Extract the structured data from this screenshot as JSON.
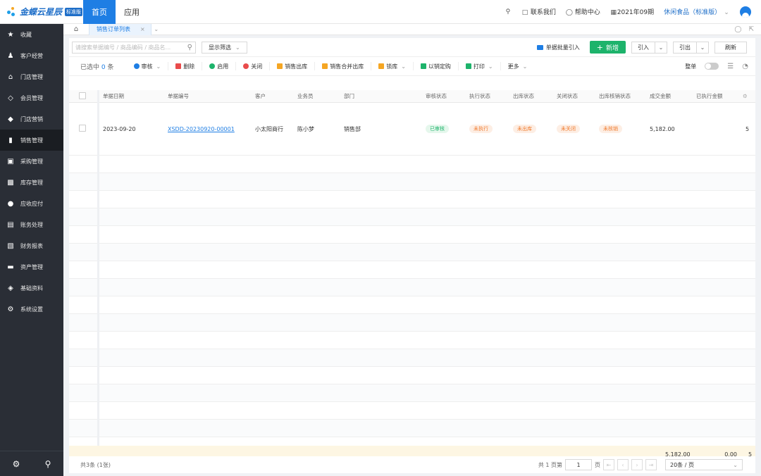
{
  "topbar": {
    "logo_text": "金蝶云星辰",
    "logo_badge": "标准版",
    "tabs": [
      "首页",
      "应用"
    ],
    "contact": "联系我们",
    "help": "帮助中心",
    "period": "2021年09期",
    "company": "休闲食品（标准版）"
  },
  "sidebar": {
    "items": [
      {
        "label": "收藏",
        "icon": "star-icon"
      },
      {
        "label": "客户经营",
        "icon": "customer-icon"
      },
      {
        "label": "门店管理",
        "icon": "store-icon"
      },
      {
        "label": "会员管理",
        "icon": "member-icon"
      },
      {
        "label": "门店营销",
        "icon": "tag-icon"
      },
      {
        "label": "销售管理",
        "icon": "chart-bar-icon"
      },
      {
        "label": "采购管理",
        "icon": "cart-icon"
      },
      {
        "label": "库存管理",
        "icon": "box-icon"
      },
      {
        "label": "应收应付",
        "icon": "coin-icon"
      },
      {
        "label": "账务处理",
        "icon": "ledger-icon"
      },
      {
        "label": "财务报表",
        "icon": "report-icon"
      },
      {
        "label": "资产管理",
        "icon": "asset-icon"
      },
      {
        "label": "基础资料",
        "icon": "layers-icon"
      },
      {
        "label": "系统设置",
        "icon": "gear-icon"
      }
    ],
    "active_index": 5
  },
  "tabs": {
    "current": "销售订单列表"
  },
  "search": {
    "placeholder": "请搜索单据编号 / 商品编码 / 商品名...",
    "filter_label": "显示筛选"
  },
  "actions": {
    "batch_import": "单据批量引入",
    "new": "新增",
    "import": "引入",
    "export": "引出",
    "refresh": "刷新"
  },
  "toolbar": {
    "selected_prefix": "已选中",
    "selected_count": "0",
    "selected_suffix": "条",
    "audit": "审核",
    "delete": "删除",
    "enable": "启用",
    "close": "关闭",
    "sales_out": "销售出库",
    "merge_out": "销售合并出库",
    "lock": "锁库",
    "sale_purchase": "以销定购",
    "print": "打印",
    "more": "更多",
    "whole_order": "整单"
  },
  "table": {
    "columns": [
      "单据日期",
      "单据编号",
      "客户",
      "业务员",
      "部门",
      "审核状态",
      "执行状态",
      "出库状态",
      "关闭状态",
      "出库核销状态",
      "成交金额",
      "已执行金额"
    ],
    "rows": [
      {
        "date": "2023-09-20",
        "number": "XSDD-20230920-00001",
        "customer": "小太阳商行",
        "salesman": "陈小梦",
        "dept": "销售部",
        "audit": "已审核",
        "exec": "未执行",
        "out": "未出库",
        "close": "未关闭",
        "writeoff": "未核销",
        "amount": "5,182.00",
        "edge": "5"
      }
    ],
    "summary": {
      "amount": "5,182.00",
      "executed": "0.00",
      "edge": "5"
    }
  },
  "footer": {
    "total": "共3条 (1张)",
    "page_total": "共 1 页第",
    "page_value": "1",
    "page_suffix": "页",
    "page_size": "20条 / 页"
  },
  "colors": {
    "primary": "#1e7ee4",
    "sidebar_bg": "#2a2e36",
    "new_button": "#1db36b",
    "status_green": "#1db36b",
    "status_orange": "#f07a2c",
    "summary_bg": "#fdf6e3"
  }
}
